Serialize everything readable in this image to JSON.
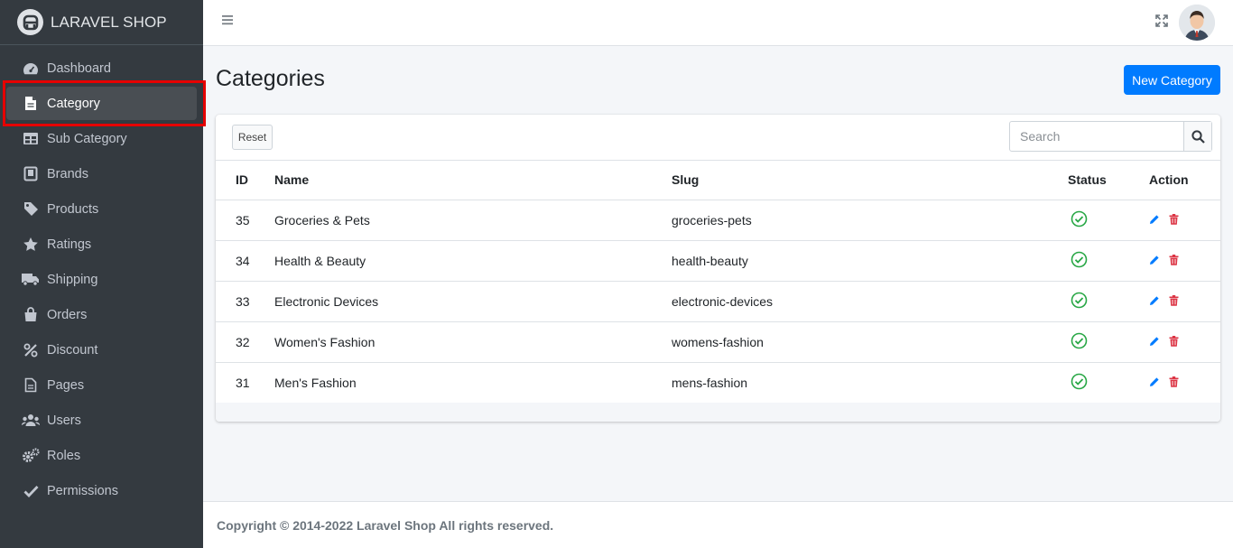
{
  "brand": {
    "name": "LARAVEL SHOP"
  },
  "sidebar": {
    "items": [
      {
        "label": "Dashboard",
        "icon": "tachometer-icon"
      },
      {
        "label": "Category",
        "icon": "file-icon",
        "active": true
      },
      {
        "label": "Sub Category",
        "icon": "table-icon"
      },
      {
        "label": "Brands",
        "icon": "book-icon"
      },
      {
        "label": "Products",
        "icon": "tag-icon"
      },
      {
        "label": "Ratings",
        "icon": "star-icon"
      },
      {
        "label": "Shipping",
        "icon": "truck-icon"
      },
      {
        "label": "Orders",
        "icon": "shopping-bag-icon"
      },
      {
        "label": "Discount",
        "icon": "percent-icon"
      },
      {
        "label": "Pages",
        "icon": "file-alt-icon"
      },
      {
        "label": "Users",
        "icon": "users-icon"
      },
      {
        "label": "Roles",
        "icon": "cogs-icon"
      },
      {
        "label": "Permissions",
        "icon": "check-icon"
      }
    ]
  },
  "header": {
    "menu_icon": "hamburger-icon",
    "fullscreen_icon": "expand-icon",
    "avatar_icon": "user-avatar"
  },
  "main": {
    "title": "Categories",
    "new_button": "New Category",
    "reset_button": "Reset",
    "search": {
      "placeholder": "Search",
      "value": ""
    },
    "table": {
      "headers": [
        "ID",
        "Name",
        "Slug",
        "Status",
        "Action"
      ],
      "rows": [
        {
          "id": "35",
          "name": "Groceries & Pets",
          "slug": "groceries-pets",
          "status": "active"
        },
        {
          "id": "34",
          "name": "Health & Beauty",
          "slug": "health-beauty",
          "status": "active"
        },
        {
          "id": "33",
          "name": "Electronic Devices",
          "slug": "electronic-devices",
          "status": "active"
        },
        {
          "id": "32",
          "name": "Women's Fashion",
          "slug": "womens-fashion",
          "status": "active"
        },
        {
          "id": "31",
          "name": "Men's Fashion",
          "slug": "mens-fashion",
          "status": "active"
        }
      ]
    }
  },
  "footer": {
    "text": "Copyright © 2014-2022 Laravel Shop All rights reserved."
  },
  "colors": {
    "sidebar": "#343a40",
    "primary": "#007bff",
    "success": "#28a745",
    "danger": "#dc3545",
    "highlight": "#e60000"
  }
}
